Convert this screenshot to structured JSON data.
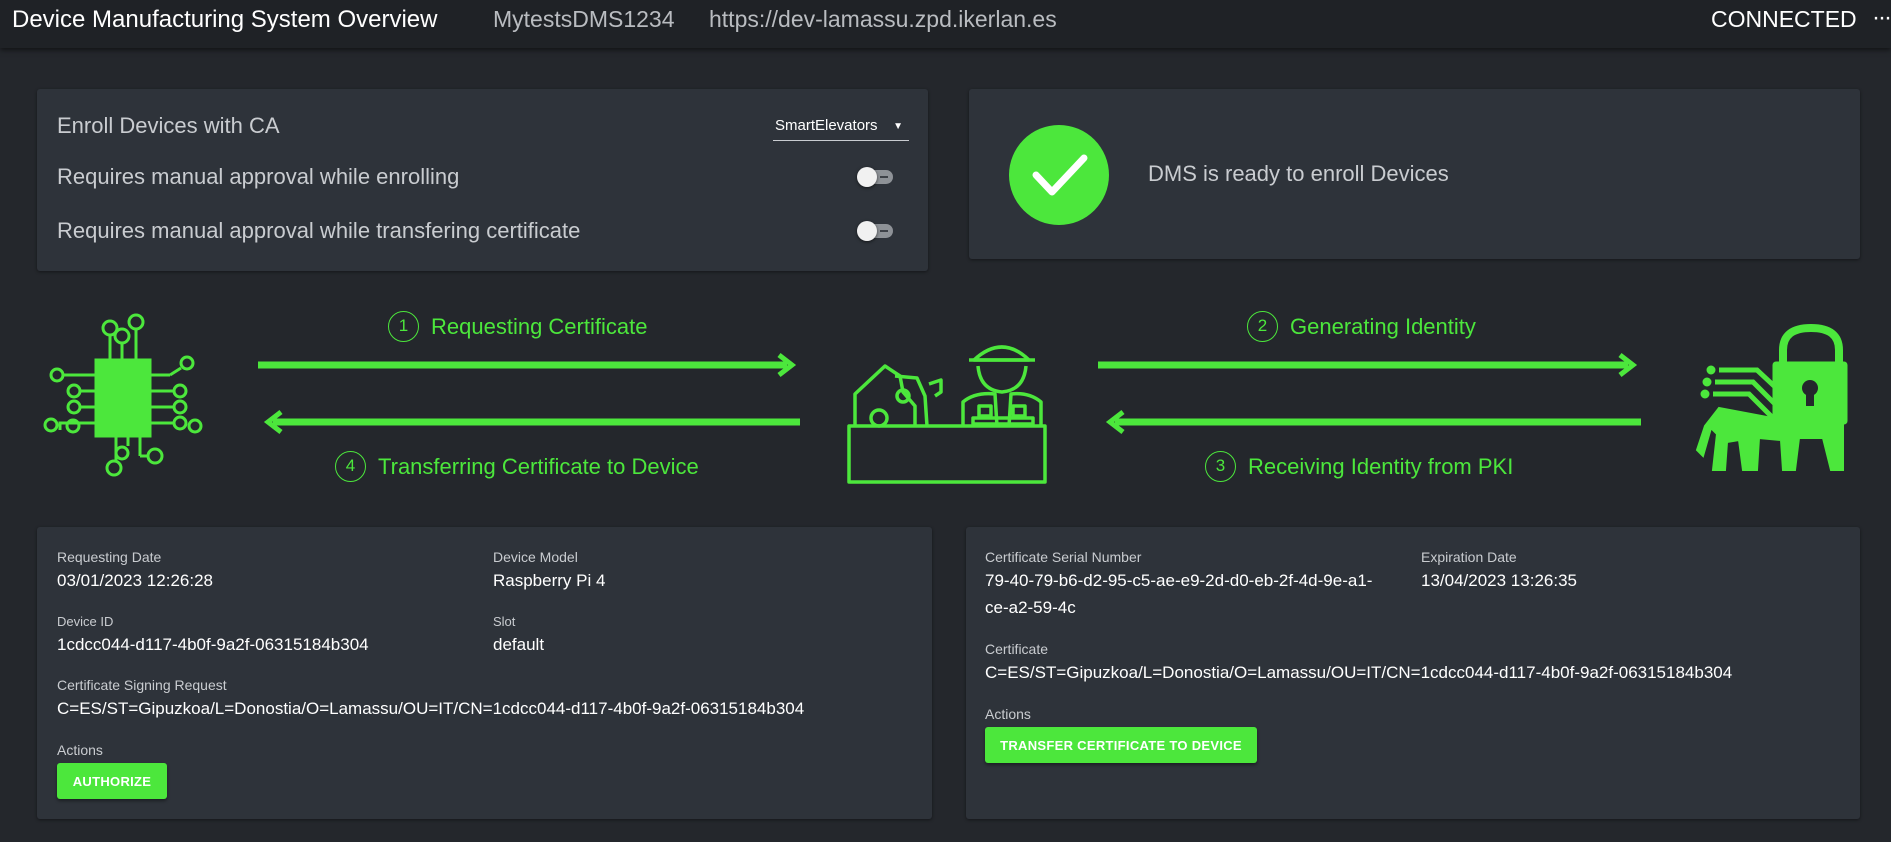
{
  "header": {
    "title": "Device Manufacturing System Overview",
    "dms_name": "MytestsDMS1234",
    "url": "https://dev-lamassu.zpd.ikerlan.es",
    "connection_status": "CONNECTED",
    "more_icon": "more-horizontal-icon"
  },
  "config": {
    "enroll_label": "Enroll Devices with CA",
    "ca_selected": "SmartElevators",
    "manual_enroll_label": "Requires manual approval while enrolling",
    "manual_enroll_on": false,
    "manual_transfer_label": "Requires manual approval while transfering certificate",
    "manual_transfer_on": false
  },
  "status": {
    "icon": "check-circle-icon",
    "message": "DMS is ready to enroll Devices"
  },
  "flow": {
    "steps": [
      {
        "num": "1",
        "label": "Requesting Certificate"
      },
      {
        "num": "2",
        "label": "Generating Identity"
      },
      {
        "num": "3",
        "label": "Receiving Identity from PKI"
      },
      {
        "num": "4",
        "label": "Transferring Certificate to Device"
      }
    ],
    "icons": [
      "chip-icon",
      "factory-worker-icon",
      "lamassu-lock-icon"
    ],
    "accent": "#4ce73c"
  },
  "request": {
    "requesting_date_label": "Requesting Date",
    "requesting_date": "03/01/2023 12:26:28",
    "device_model_label": "Device Model",
    "device_model": "Raspberry Pi 4",
    "device_id_label": "Device ID",
    "device_id": "1cdcc044-d117-4b0f-9a2f-06315184b304",
    "slot_label": "Slot",
    "slot": "default",
    "csr_label": "Certificate Signing Request",
    "csr": "C=ES/ST=Gipuzkoa/L=Donostia/O=Lamassu/OU=IT/CN=1cdcc044-d117-4b0f-9a2f-06315184b304",
    "actions_label": "Actions",
    "authorize_button": "AUTHORIZE"
  },
  "certificate": {
    "serial_label": "Certificate Serial Number",
    "serial_line1": "79-40-79-b6-d2-95-c5-ae-e9-2d-d0-eb-2f-4d-9e-a1-",
    "serial_line2": "ce-a2-59-4c",
    "expiration_label": "Expiration Date",
    "expiration": "13/04/2023 13:26:35",
    "certificate_label": "Certificate",
    "certificate": "C=ES/ST=Gipuzkoa/L=Donostia/O=Lamassu/OU=IT/CN=1cdcc044-d117-4b0f-9a2f-06315184b304",
    "actions_label": "Actions",
    "transfer_button": "TRANSFER CERTIFICATE TO DEVICE"
  }
}
